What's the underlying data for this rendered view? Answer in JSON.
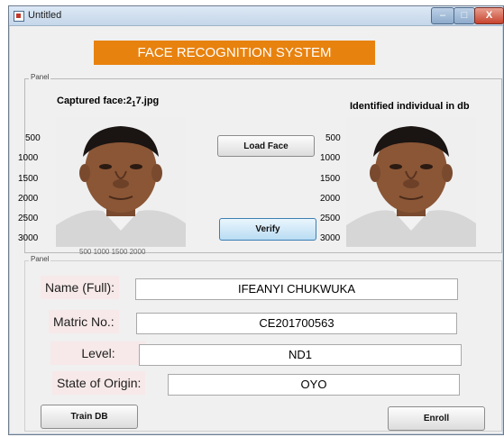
{
  "window": {
    "title": "Untitled",
    "controls": {
      "minimize": "–",
      "maximize": "□",
      "close": "X"
    }
  },
  "banner": {
    "text": "FACE RECOGNITION SYSTEM"
  },
  "panel1": {
    "label": "Panel",
    "captured": {
      "title_pre": "Captured face:2",
      "title_sub": "1",
      "title_post": "7.jpg",
      "yticks": [
        "500",
        "1000",
        "1500",
        "2000",
        "2500",
        "3000"
      ],
      "xticks_partial": "500   1000  1500  2000"
    },
    "identified": {
      "title": "Identified individual in db",
      "yticks": [
        "500",
        "1000",
        "1500",
        "2000",
        "2500",
        "3000"
      ]
    },
    "load_face_button": "Load Face",
    "verify_button": "Verify"
  },
  "panel2": {
    "label": "Panel",
    "fields": {
      "name": {
        "label": "Name (Full):",
        "value": "IFEANYI CHUKWUKA"
      },
      "matric": {
        "label": "Matric No.:",
        "value": "CE201700563"
      },
      "level": {
        "label": "Level:",
        "value": "ND1"
      },
      "state": {
        "label": "State of Origin:",
        "value": "OYO"
      }
    },
    "train_button": "Train DB",
    "enroll_button": "Enroll"
  },
  "colors": {
    "banner_bg": "#e8820f",
    "skin": "#8a5636",
    "shirt": "#d8d8d8",
    "hair": "#1a1412"
  }
}
